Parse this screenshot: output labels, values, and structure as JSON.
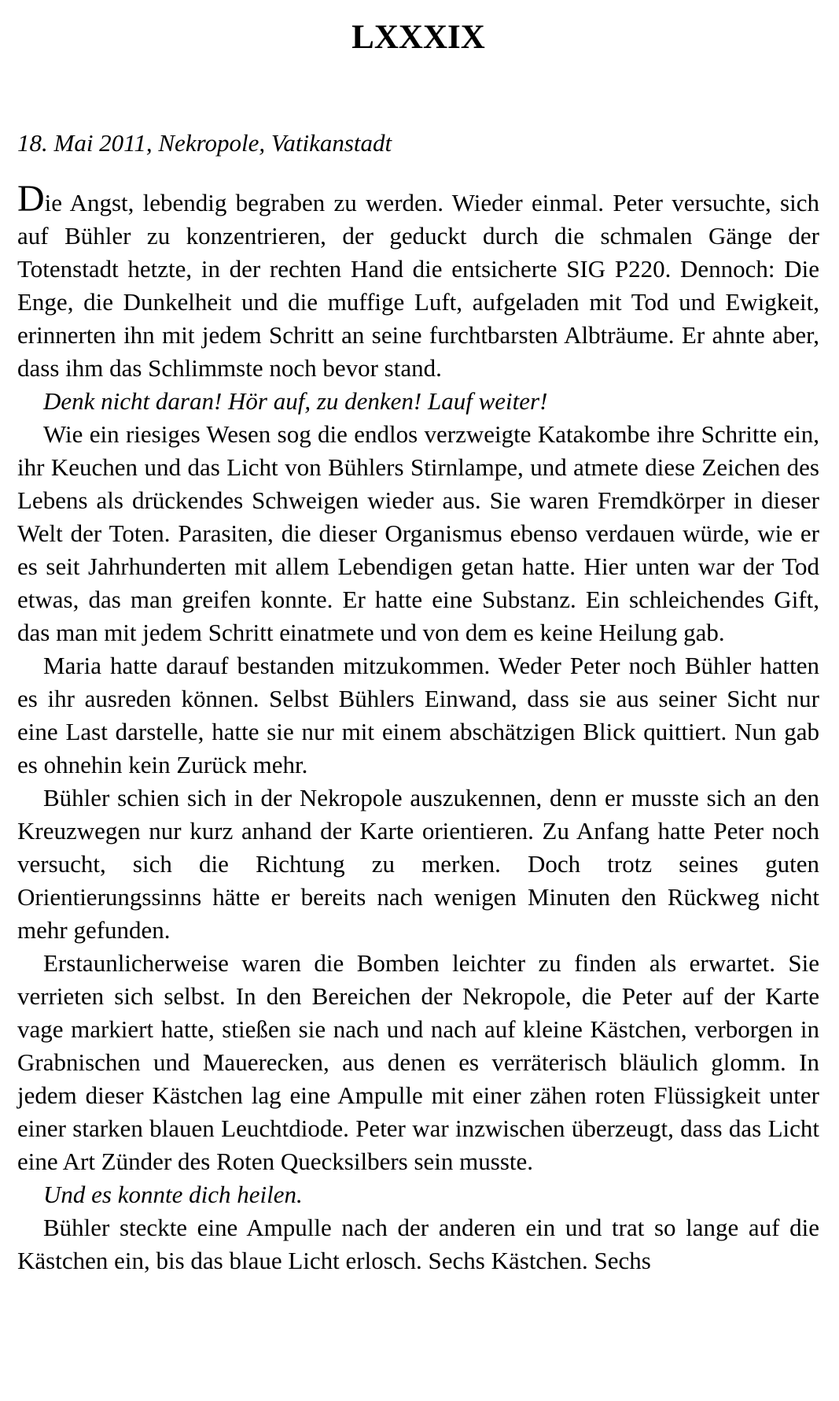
{
  "chapter": {
    "title": "LXXXIX"
  },
  "dateline": "18. Mai 2011, Nekropole, Vatikanstadt",
  "paragraphs": [
    {
      "initial": "D",
      "rest": "ie Angst, lebendig begraben zu werden. Wieder einmal. Peter versuchte, sich auf Bühler zu konzentrieren, der geduckt durch die schmalen Gänge der Totenstadt hetzte, in der rechten Hand die entsicherte SIG P220. Dennoch: Die Enge, die Dunkelheit und die muffige Luft, aufgeladen mit Tod und Ewigkeit, erinnerten ihn mit jedem Schritt an seine furchtbarsten Albträume. Er ahnte aber, dass ihm das Schlimmste noch bevor stand."
    },
    {
      "text": "Denk nicht daran! Hör auf, zu denken! Lauf weiter!"
    },
    {
      "text": "Wie ein riesiges Wesen sog die endlos verzweigte Katakombe ihre Schritte ein, ihr Keuchen und das Licht von Bühlers Stirnlampe, und atmete diese Zeichen des Lebens als drückendes Schweigen wieder aus. Sie waren Fremdkörper in dieser Welt der Toten. Parasiten, die dieser Organismus ebenso verdauen würde, wie er es seit Jahrhunderten mit allem Lebendigen getan hatte. Hier unten war der Tod etwas, das man greifen konnte. Er hatte eine Substanz. Ein schleichendes Gift, das man mit jedem Schritt einatmete und von dem es keine Heilung gab."
    },
    {
      "text": "Maria hatte darauf bestanden mitzukommen. Weder Peter noch Bühler hatten es ihr ausreden können. Selbst Bühlers Einwand, dass sie aus seiner Sicht nur eine Last darstelle, hatte sie nur mit einem abschätzigen Blick quittiert. Nun gab es ohnehin kein Zurück mehr."
    },
    {
      "text": "Bühler schien sich in der Nekropole auszukennen, denn er musste sich an den Kreuzwegen nur kurz anhand der Karte orientieren. Zu Anfang hatte Peter noch versucht, sich die Richtung zu merken. Doch trotz seines guten Orientierungssinns hätte er bereits nach wenigen Minuten den Rückweg nicht mehr gefunden."
    },
    {
      "text": "Erstaunlicherweise waren die Bomben leichter zu finden als erwartet. Sie verrieten sich selbst. In den Bereichen der Nekropole, die Peter auf der Karte vage markiert hatte, stießen sie nach und nach auf kleine Kästchen, verborgen in Grabnischen und Mauerecken, aus denen es verräterisch bläulich glomm. In jedem dieser Kästchen lag eine Ampulle mit einer zähen roten Flüssigkeit unter einer starken blauen Leuchtdiode. Peter war inzwischen überzeugt, dass das Licht eine Art Zünder des Roten Quecksilbers sein musste."
    },
    {
      "text": "Und es konnte dich heilen."
    },
    {
      "text": "Bühler steckte eine Ampulle nach der anderen ein und trat so lange auf die Kästchen ein, bis das blaue Licht erlosch. Sechs Kästchen. Sechs"
    }
  ]
}
